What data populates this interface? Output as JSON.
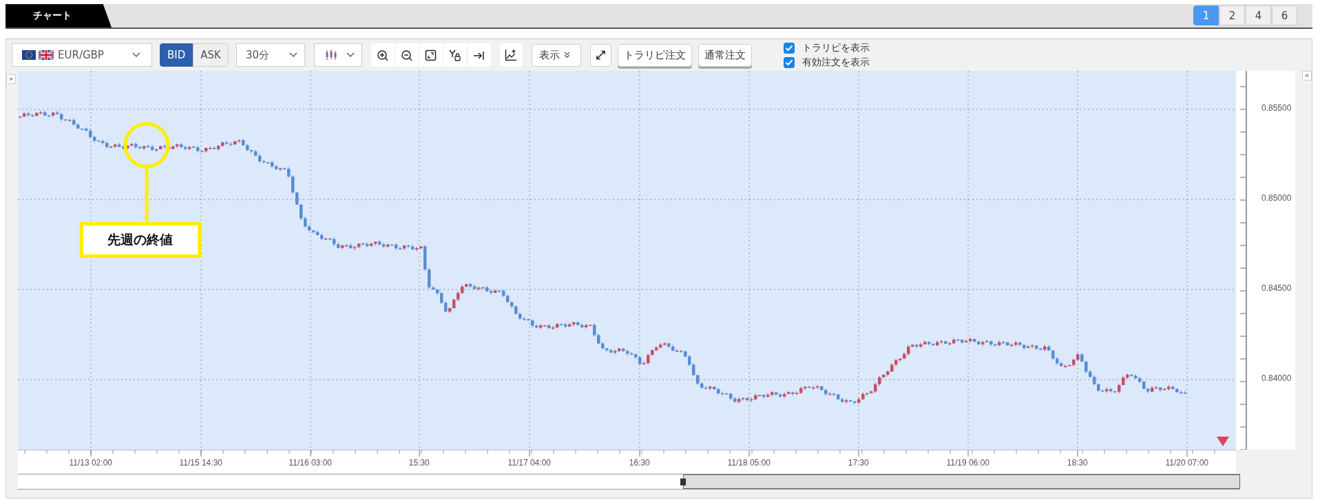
{
  "tabs": [
    {
      "label": "チャート",
      "selected": true
    }
  ],
  "layout_buttons": [
    {
      "label": "1",
      "selected": true
    },
    {
      "label": "2",
      "selected": false
    },
    {
      "label": "4",
      "selected": false
    },
    {
      "label": "6",
      "selected": false
    }
  ],
  "toolbar": {
    "symbol": "EUR/GBP",
    "price_side": [
      {
        "label": "BID",
        "selected": true
      },
      {
        "label": "ASK",
        "selected": false
      }
    ],
    "interval": "30分",
    "display_menu": "表示",
    "order_buttons": [
      "トラリピ注文",
      "通常注文"
    ],
    "checkboxes": [
      {
        "label": "トラリピを表示",
        "checked": true
      },
      {
        "label": "有効注文を表示",
        "checked": true
      }
    ]
  },
  "chart": {
    "left_toggle": "»",
    "right_toggle": "«",
    "price_labels": [
      "0.85500",
      "0.85000",
      "0.84500",
      "0.84000"
    ],
    "time_labels": [
      "11/13 02:00",
      "11/15 14:30",
      "11/16 03:00",
      "15:30",
      "11/17 04:00",
      "16:30",
      "11/18 05:00",
      "17:30",
      "11/19 06:00",
      "18:30",
      "11/20 07:00"
    ],
    "annotation": "先週の終値"
  }
}
